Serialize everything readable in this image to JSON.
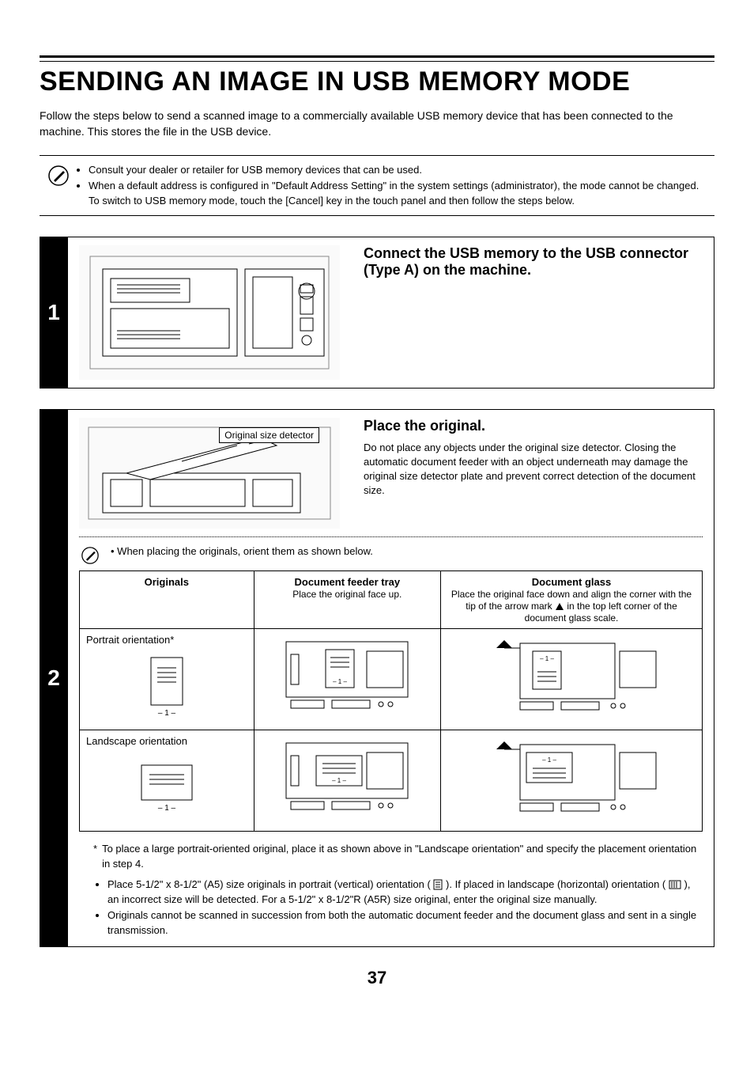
{
  "title": "SENDING AN IMAGE IN USB MEMORY MODE",
  "intro": "Follow the steps below to send a scanned image to a commercially available USB memory device that has been connected to the machine. This stores the file in the USB device.",
  "info": {
    "bullets": [
      "Consult your dealer or retailer for USB memory devices that can be used.",
      "When a default address is configured in \"Default Address Setting\" in the system settings (administrator), the mode cannot be changed. To switch to USB memory mode, touch the [Cancel] key in the touch panel and then follow the steps below."
    ]
  },
  "step1": {
    "number": "1",
    "heading": "Connect the USB memory to the USB connector (Type A) on the machine."
  },
  "step2": {
    "number": "2",
    "callout": "Original size detector",
    "heading": "Place the original.",
    "para": "Do not place any objects under the original size detector. Closing the automatic document feeder with an object underneath may damage the original size detector plate and prevent correct detection of the document size.",
    "note": "When placing the originals, orient them as shown below.",
    "table": {
      "col1": "Originals",
      "col2_title": "Document feeder tray",
      "col2_sub": "Place the original face up.",
      "col3_title": "Document glass",
      "col3_sub_a": "Place the original face down and align the corner with the tip of the arrow mark ",
      "col3_sub_b": " in the top left corner of the document glass scale.",
      "row1_label": "Portrait orientation*",
      "row2_label": "Landscape orientation"
    },
    "footnote_star": "To place a large portrait-oriented original, place it as shown above in \"Landscape orientation\" and specify the placement orientation in step 4.",
    "footnote_bullets_a": "Place 5-1/2\" x 8-1/2\" (A5) size originals in portrait (vertical) orientation (",
    "footnote_bullets_a2": "). If placed in landscape (horizontal) orientation (",
    "footnote_bullets_a3": "), an incorrect size will be detected. For a 5-1/2\" x 8-1/2\"R (A5R) size original, enter the original size manually.",
    "footnote_bullets_b": "Originals cannot be scanned in succession from both the automatic document feeder and the document glass and sent in a single transmission."
  },
  "page_number": "37"
}
